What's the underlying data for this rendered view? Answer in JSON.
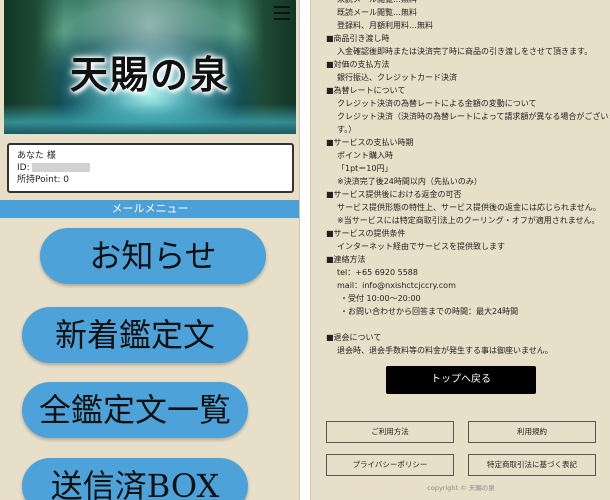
{
  "left": {
    "site_title": "天賜の泉",
    "user": {
      "name_line": "あなた 様",
      "id_label": "ID:",
      "points_line": "所持Point: 0"
    },
    "menu_header": "メールメニュー",
    "menu_buttons": [
      {
        "label": "お知らせ"
      },
      {
        "label": "新着鑑定文"
      },
      {
        "label": "全鑑定文一覧"
      },
      {
        "label": "送信済BOX"
      }
    ]
  },
  "right": {
    "lines": [
      {
        "text": "未読メール閲覧…無料",
        "indent": "sub"
      },
      {
        "text": "既読メール閲覧…無料",
        "indent": "sub"
      },
      {
        "text": "登録料、月額利用料…無料",
        "indent": "sub"
      },
      {
        "text": "■商品引き渡し時",
        "indent": ""
      },
      {
        "text": "入金確認後即時または決済完了時に商品の引き渡しをさせて頂きます。",
        "indent": "sub"
      },
      {
        "text": "■対価の支払方法",
        "indent": ""
      },
      {
        "text": "銀行振込、クレジットカード決済",
        "indent": "sub"
      },
      {
        "text": "■為替レートについて",
        "indent": ""
      },
      {
        "text": "クレジット決済の為替レートによる金額の変動について",
        "indent": "sub"
      },
      {
        "text": "クレジット決済（決済時の為替レートによって請求額が異なる場合がございま",
        "indent": "sub"
      },
      {
        "text": "す。）",
        "indent": "sub"
      },
      {
        "text": "■サービスの支払い時期",
        "indent": ""
      },
      {
        "text": "ポイント購入時",
        "indent": "sub"
      },
      {
        "text": "「1pt＝10円」",
        "indent": "sub"
      },
      {
        "text": "※決済完了後24時間以内（先払いのみ）",
        "indent": "sub"
      },
      {
        "text": "■サービス提供後における返金の可否",
        "indent": ""
      },
      {
        "text": "サービス提供形態の特性上、サービス提供後の返金には応じられません。",
        "indent": "sub"
      },
      {
        "text": "※当サービスには特定商取引法上のクーリング・オフが適用されません。",
        "indent": "sub"
      },
      {
        "text": "■サービスの提供条件",
        "indent": ""
      },
      {
        "text": "インターネット経由でサービスを提供致します",
        "indent": "sub"
      },
      {
        "text": "■連絡方法",
        "indent": ""
      },
      {
        "text": "tel：+65 6920 5588",
        "indent": "sub"
      },
      {
        "text": "mail：info@nxishctcjccry.com",
        "indent": "sub"
      },
      {
        "text": "・受付 10:00〜20:00",
        "indent": "sub2"
      },
      {
        "text": "・お問い合わせから回答までの時間：最大24時間",
        "indent": "sub2"
      },
      {
        "text": "",
        "indent": "gap"
      },
      {
        "text": "■退会について",
        "indent": ""
      },
      {
        "text": "退会時、退会手数料等の料金が発生する事は御座いません。",
        "indent": "sub"
      }
    ],
    "back_to_top": "トップへ戻る",
    "footer_buttons": [
      "ご利用方法",
      "利用規約",
      "プライバシーポリシー",
      "特定商取引法に基づく表記"
    ],
    "copyright": "copyright © 天賜の泉"
  }
}
